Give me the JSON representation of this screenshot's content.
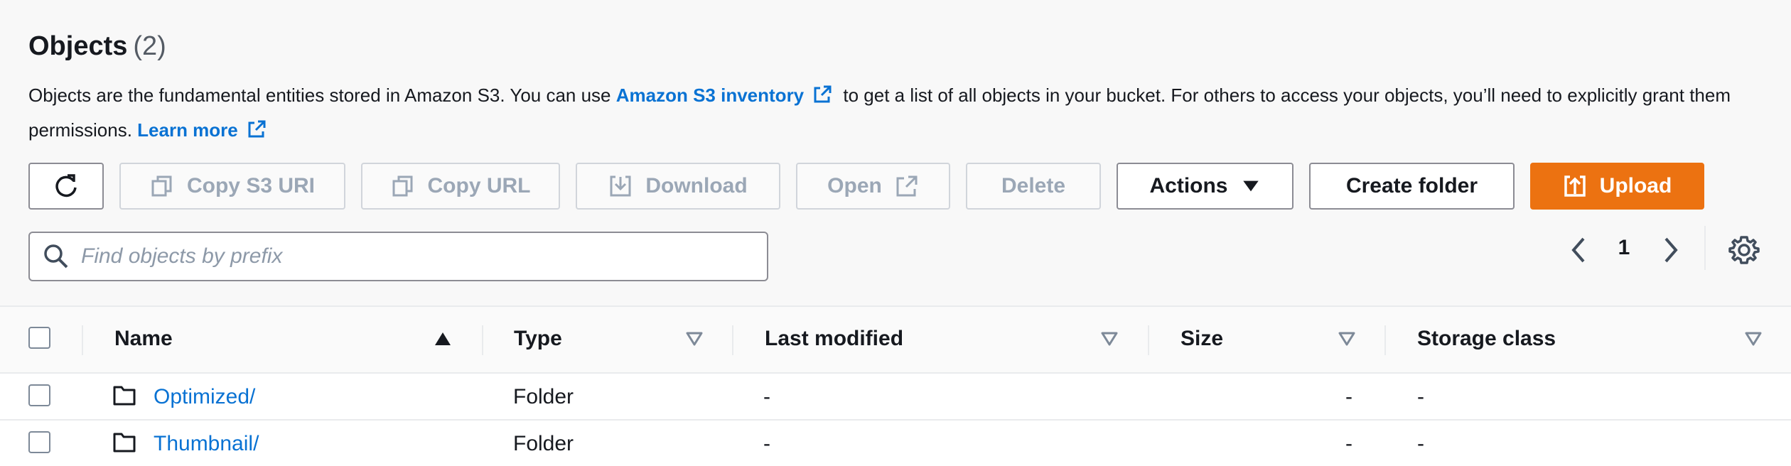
{
  "header": {
    "title": "Objects",
    "count": "(2)",
    "desc_part1": "Objects are the fundamental entities stored in Amazon S3. You can use ",
    "inventory_link": "Amazon S3 inventory",
    "desc_part2": " to get a list of all objects in your bucket. For others to access your objects, you’ll need to explicitly grant them permissions. ",
    "learn_more": "Learn more"
  },
  "toolbar": {
    "refresh_icon": "refresh-icon",
    "copy_s3_uri": "Copy S3 URI",
    "copy_url": "Copy URL",
    "download": "Download",
    "open": "Open",
    "delete": "Delete",
    "actions": "Actions",
    "create_folder": "Create folder",
    "upload": "Upload"
  },
  "search": {
    "placeholder": "Find objects by prefix",
    "value": ""
  },
  "pagination": {
    "current_page": "1"
  },
  "table": {
    "columns": [
      "Name",
      "Type",
      "Last modified",
      "Size",
      "Storage class"
    ],
    "rows": [
      {
        "name": "Optimized/",
        "type": "Folder",
        "last_modified": "-",
        "size": "-",
        "storage_class": "-"
      },
      {
        "name": "Thumbnail/",
        "type": "Folder",
        "last_modified": "-",
        "size": "-",
        "storage_class": "-"
      }
    ]
  },
  "colors": {
    "accent": "#ec7211",
    "link": "#0972d3",
    "disabled_text": "#9ba7b6",
    "text": "#16191f"
  }
}
